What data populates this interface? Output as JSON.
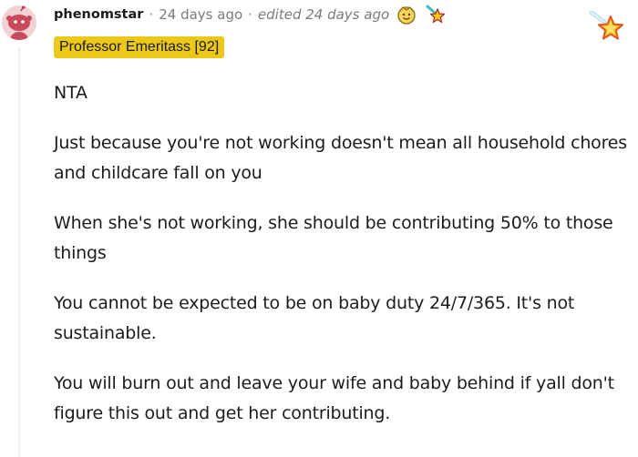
{
  "comment": {
    "username": "phenomstar",
    "separator": "·",
    "posted_time": "24 days ago",
    "edited_time": "edited 24 days ago",
    "flair": "Professor Emeritass [92]",
    "paragraphs": [
      "NTA",
      "Just because you're not working doesn't mean all household chores and childcare fall on you",
      "When she's not working, she should be contributing 50% to those things",
      "You cannot be expected to be on baby duty 24/7/365. It's not sustainable.",
      "You will burn out and leave your wife and baby behind if yall don't figure this out and get her contributing."
    ]
  },
  "icons": {
    "avatar": "snoo-avatar-icon",
    "award_1": "helpful-award-icon",
    "award_2": "rocket-like-award-icon",
    "corner_award": "shooting-star-award-icon"
  },
  "colors": {
    "flair_background": "#ecc918",
    "avatar_background": "#f3d2d4",
    "meta_text": "#787c7e",
    "thread_line": "#edeff1"
  }
}
